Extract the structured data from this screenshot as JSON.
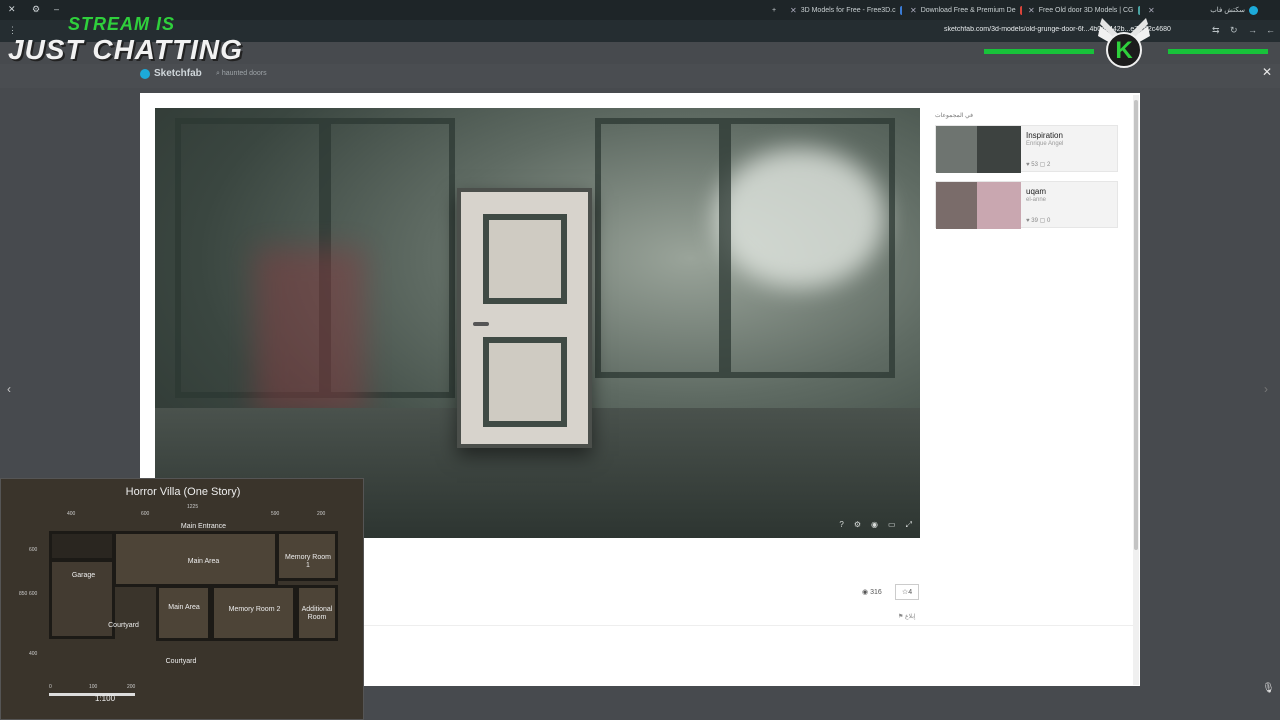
{
  "browser": {
    "tabs": [
      {
        "title": "3D Models for Free - Free3D.c",
        "icon_color": "#3a7bd5"
      },
      {
        "title": "Download Free & Premium De",
        "icon_color": "#d9443a"
      },
      {
        "title": "Free Old door 3D Models | CG",
        "icon_color": "#4aa3a3"
      },
      {
        "title": "سكتش فاب",
        "icon_color": "#1caad9"
      }
    ],
    "new_tab_label": "+",
    "url": "sketchfab.com/3d-models/old-grunge-door-6f...4b0d3442b...e7f262c4680"
  },
  "stream_overlay": {
    "line1": "STREAM IS",
    "line2": "JUST CHATTING",
    "accent_color": "#2fd03c",
    "logo_letter": "K"
  },
  "sketchfab": {
    "brand": "Sketchfab",
    "search_value": "haunted doors",
    "viewer_icons": [
      "help-icon",
      "settings-icon",
      "vr-icon",
      "fullscreen-icon"
    ],
    "sidebar_heading": "في المجموعات",
    "collections": [
      {
        "name": "Inspiration",
        "author": "Enrique Angel",
        "likes": "53",
        "models": "2"
      },
      {
        "name": "uqam",
        "author": "el-anne",
        "likes": "39",
        "models": "0"
      }
    ],
    "views": "316",
    "likes": "4",
    "report_label": "إبلاغ"
  },
  "floorplan": {
    "title": "Horror Villa (One Story)",
    "rooms": {
      "main_entrance": "Main Entrance",
      "main_area": "Main Area",
      "memory_room_1": "Memory Room 1",
      "garage": "Garage",
      "courtyard_left": "Courtyard",
      "main_area_2": "Main Area",
      "memory_room_2": "Memory Room 2",
      "additional_room": "Additional Room",
      "courtyard_bottom": "Courtyard"
    },
    "dims_top": [
      "400",
      "600",
      "1225",
      "590",
      "200"
    ],
    "dims_left": [
      "600",
      "850",
      "600",
      "400"
    ],
    "scale_ticks": [
      "0",
      "100",
      "200"
    ],
    "scale": "1:100"
  }
}
